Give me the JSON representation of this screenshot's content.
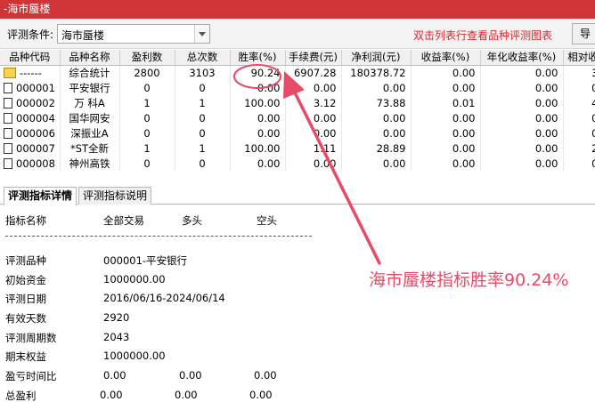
{
  "window": {
    "title": "-海市蜃楼"
  },
  "toolbar": {
    "condition_label": "评测条件:",
    "condition_value": "海市蜃楼",
    "hint": "双击列表行查看品种评测图表",
    "export_label": "导"
  },
  "table": {
    "headers": [
      "品种代码",
      "品种名称",
      "盈利数",
      "总次数",
      "胜率(%)",
      "手续费(元)",
      "净利润(元)",
      "收益率(%)",
      "年化收益率(%)",
      "相对收"
    ],
    "rows": [
      [
        "------",
        "综合统计",
        "2800",
        "3103",
        "90.24",
        "6907.28",
        "180378.72",
        "0.00",
        "0.00",
        "3"
      ],
      [
        "000001",
        "平安银行",
        "0",
        "0",
        "0.00",
        "0.00",
        "0.00",
        "0.00",
        "0.00",
        "0"
      ],
      [
        "000002",
        "万 科A",
        "1",
        "1",
        "100.00",
        "3.12",
        "73.88",
        "0.01",
        "0.00",
        "4"
      ],
      [
        "000004",
        "国华网安",
        "0",
        "0",
        "0.00",
        "0.00",
        "0.00",
        "0.00",
        "0.00",
        "0"
      ],
      [
        "000006",
        "深振业A",
        "0",
        "0",
        "0.00",
        "0.00",
        "0.00",
        "0.00",
        "0.00",
        "0"
      ],
      [
        "000007",
        "*ST全新",
        "1",
        "1",
        "100.00",
        "1.11",
        "28.89",
        "0.00",
        "0.00",
        "2"
      ],
      [
        "000008",
        "神州高铁",
        "0",
        "0",
        "0.00",
        "0.00",
        "0.00",
        "0.00",
        "0.00",
        "0"
      ]
    ]
  },
  "tabs": [
    {
      "label": "评测指标详情",
      "active": true
    },
    {
      "label": "评测指标说明",
      "active": false
    }
  ],
  "details": {
    "headers": [
      "指标名称",
      "全部交易",
      "多头",
      "空头"
    ],
    "items": [
      {
        "label": "评测品种",
        "values": [
          "000001-平安银行"
        ]
      },
      {
        "label": "初始资金",
        "values": [
          "1000000.00"
        ]
      },
      {
        "label": "评测日期",
        "values": [
          "2016/06/16-2024/06/14"
        ]
      },
      {
        "label": "有效天数",
        "values": [
          "2920"
        ]
      },
      {
        "label": "评测周期数",
        "values": [
          "2043"
        ]
      },
      {
        "label": "期末权益",
        "values": [
          "1000000.00"
        ]
      },
      {
        "label": "盈亏时间比",
        "values": [
          "0.00",
          "0.00",
          "0.00"
        ]
      },
      {
        "label": "总盈利",
        "values": [
          "0.00",
          "0.00",
          "0.00"
        ]
      }
    ]
  },
  "annotation": {
    "text": "海市蜃楼指标胜率90.24%",
    "color": "#e94a67"
  },
  "colors": {
    "titlebar": "#cf3536",
    "hint": "#e0262b",
    "annotation": "#e94a67"
  }
}
